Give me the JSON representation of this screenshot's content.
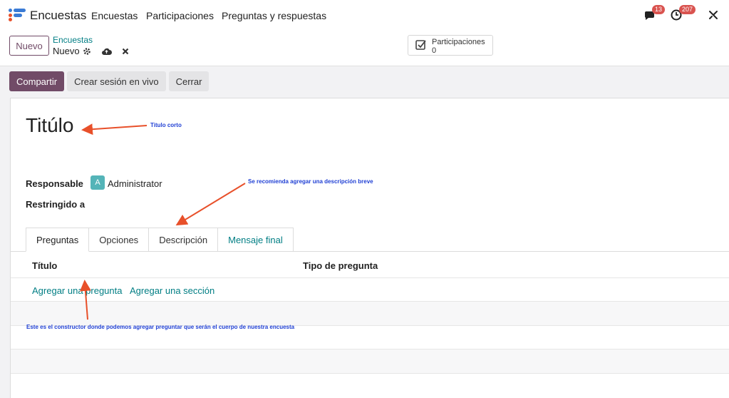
{
  "topbar": {
    "app_name": "Encuestas",
    "nav": [
      "Encuestas",
      "Participaciones",
      "Preguntas y respuestas"
    ],
    "messages_badge": "13",
    "activities_badge": "207"
  },
  "control_panel": {
    "new_button": "Nuevo",
    "breadcrumb_parent": "Encuestas",
    "breadcrumb_current": "Nuevo",
    "stat_label": "Participaciones",
    "stat_value": "0"
  },
  "actions": {
    "share": "Compartir",
    "live_session": "Crear sesión en vivo",
    "close": "Cerrar"
  },
  "form": {
    "title_placeholder": "Titúlo",
    "responsible_label": "Responsable",
    "responsible_initial": "A",
    "responsible_value": "Administrator",
    "restricted_label": "Restringido a",
    "tabs": [
      "Preguntas",
      "Opciones",
      "Descripción",
      "Mensaje final"
    ],
    "columns": [
      "Título",
      "Tipo de pregunta"
    ],
    "add_question": "Agregar una pregunta",
    "add_section": "Agregar una sección"
  },
  "annotations": {
    "short_title": "Titulo corto",
    "description_hint": "Se recomienda agregar una descripción breve",
    "builder_hint": "Este es el constructor donde podemos agregar preguntar que serán el cuerpo de nuestra encuesta"
  },
  "colors": {
    "primary": "#714b67",
    "link": "#017e84",
    "annotation_arrow": "#e8502a",
    "annotation_text": "#1f3fd4",
    "badge": "#d9534f"
  }
}
